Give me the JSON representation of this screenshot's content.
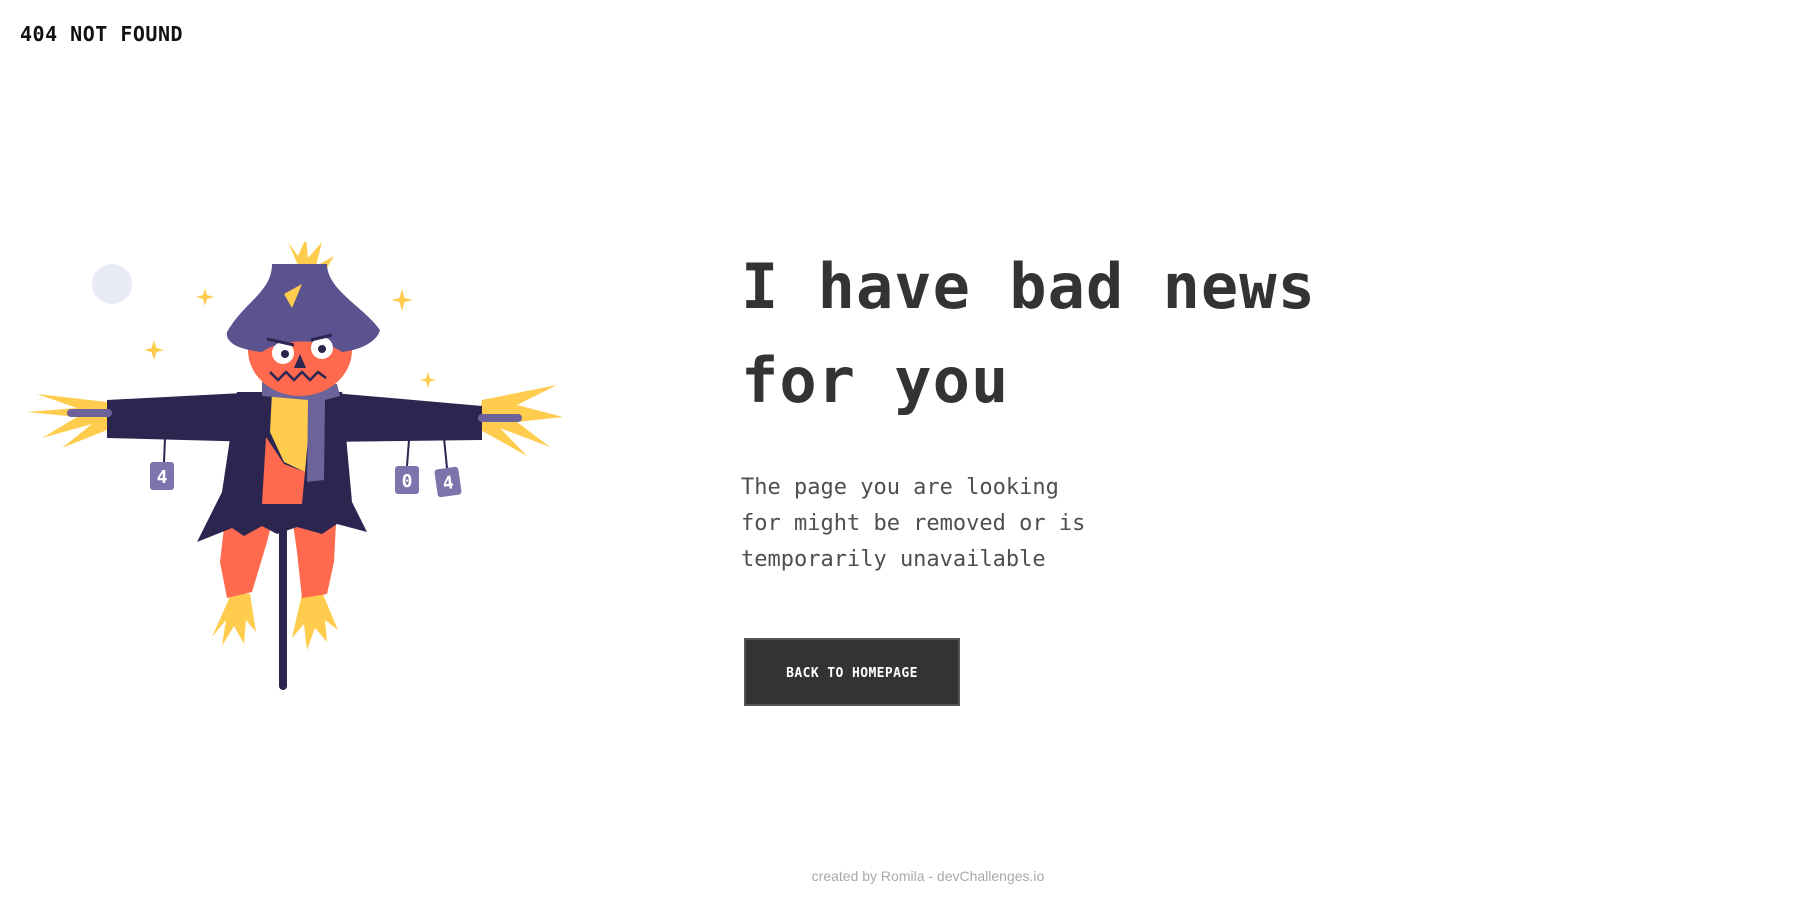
{
  "header": {
    "logo": "404 NOT FOUND"
  },
  "main": {
    "headline_line1": "I have bad news",
    "headline_line2": "for you",
    "message_line1": "The page you are looking",
    "message_line2": "for might be removed or is",
    "message_line3": "temporarily unavailable",
    "button_label": "BACK TO HOMEPAGE"
  },
  "illustration": {
    "name": "scarecrow-illustration",
    "can_labels": [
      "4",
      "0",
      "4"
    ]
  },
  "footer": {
    "credit": "created by Romila - devChallenges.io"
  },
  "colors": {
    "text": "#333333",
    "button_bg": "#333333",
    "button_text": "#ffffff",
    "hat": "#5a5390",
    "face": "#ff6a4f",
    "coat": "#2b2550",
    "straw": "#ffcc4d",
    "scarf": "#6b639a",
    "moon": "#e8ebf5"
  }
}
